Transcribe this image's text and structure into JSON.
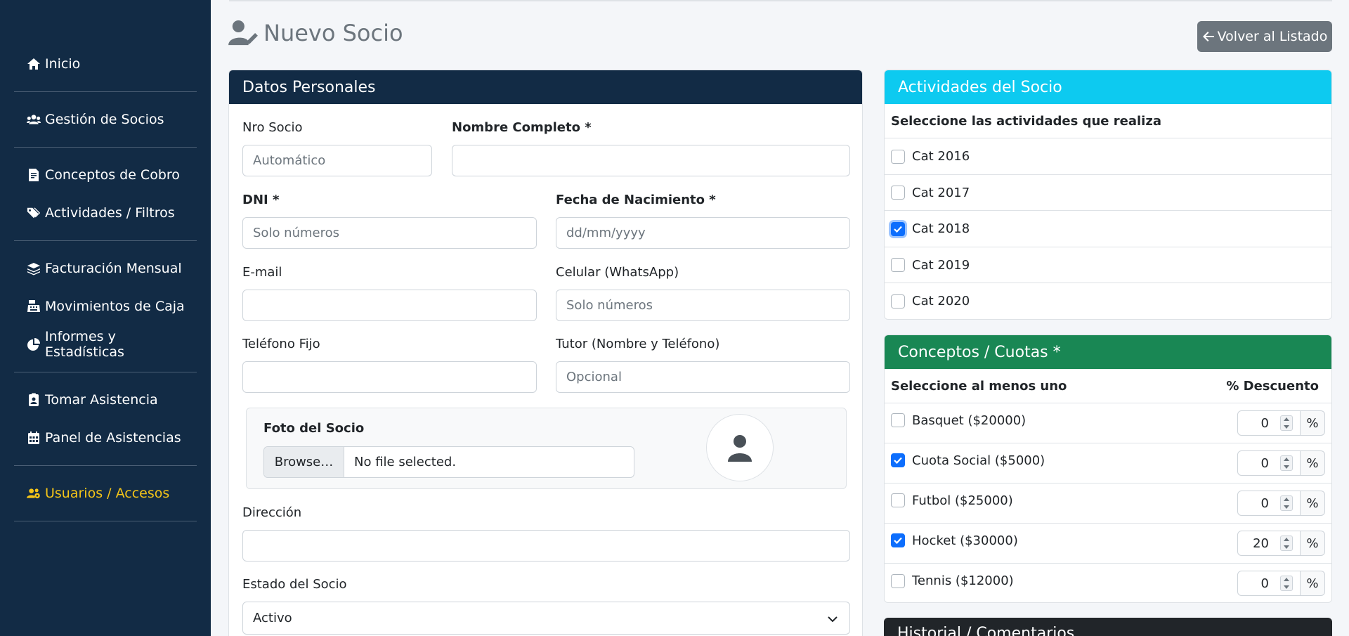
{
  "sidebar": {
    "items": [
      {
        "label": "Inicio",
        "icon": "home-icon"
      },
      {
        "label": "Gestión de Socios",
        "icon": "users-icon"
      },
      {
        "label": "Conceptos de Cobro",
        "icon": "file-invoice-icon"
      },
      {
        "label": "Actividades / Filtros",
        "icon": "tags-icon"
      },
      {
        "label": "Facturación Mensual",
        "icon": "layers-icon"
      },
      {
        "label": "Movimientos de Caja",
        "icon": "cash-register-icon"
      },
      {
        "label": "Informes y Estadísticas",
        "icon": "pie-chart-icon"
      },
      {
        "label": "Tomar Asistencia",
        "icon": "clipboard-user-icon"
      },
      {
        "label": "Panel de Asistencias",
        "icon": "calendar-icon"
      },
      {
        "label": "Usuarios / Accesos",
        "icon": "users-cog-icon",
        "active": true
      }
    ],
    "active_color": "#f5c518"
  },
  "header": {
    "title": "Nuevo Socio",
    "back_button": "Volver al Listado"
  },
  "personal": {
    "title": "Datos Personales",
    "nro_socio": {
      "label": "Nro Socio",
      "placeholder": "Automático"
    },
    "nombre": {
      "label": "Nombre Completo *",
      "value": ""
    },
    "dni": {
      "label": "DNI *",
      "placeholder": "Solo números"
    },
    "fecha": {
      "label": "Fecha de Nacimiento *",
      "placeholder": "dd/mm/yyyy"
    },
    "email": {
      "label": "E-mail",
      "value": ""
    },
    "celular": {
      "label": "Celular (WhatsApp)",
      "placeholder": "Solo números"
    },
    "telefono": {
      "label": "Teléfono Fijo",
      "value": ""
    },
    "tutor": {
      "label": "Tutor (Nombre y Teléfono)",
      "placeholder": "Opcional"
    },
    "foto": {
      "label": "Foto del Socio",
      "browse": "Browse…",
      "file": "No file selected."
    },
    "direccion": {
      "label": "Dirección",
      "value": ""
    },
    "estado": {
      "label": "Estado del Socio",
      "value": "Activo"
    }
  },
  "actividades": {
    "title": "Actividades del Socio",
    "subtitle": "Seleccione las actividades que realiza",
    "items": [
      {
        "label": "Cat 2016",
        "checked": false
      },
      {
        "label": "Cat 2017",
        "checked": false
      },
      {
        "label": "Cat 2018",
        "checked": true
      },
      {
        "label": "Cat 2019",
        "checked": false
      },
      {
        "label": "Cat 2020",
        "checked": false
      }
    ]
  },
  "conceptos": {
    "title": "Conceptos / Cuotas *",
    "subtitle": "Seleccione al menos uno",
    "discount_header": "% Descuento",
    "percent_symbol": "%",
    "items": [
      {
        "label": "Basquet ($20000)",
        "checked": false,
        "discount": "0"
      },
      {
        "label": "Cuota Social ($5000)",
        "checked": true,
        "discount": "0"
      },
      {
        "label": "Futbol ($25000)",
        "checked": false,
        "discount": "0"
      },
      {
        "label": "Hocket ($30000)",
        "checked": true,
        "discount": "20"
      },
      {
        "label": "Tennis ($12000)",
        "checked": false,
        "discount": "0"
      }
    ]
  },
  "historial": {
    "title": "Historial / Comentarios"
  },
  "colors": {
    "sidebar": "#122b45",
    "accent_cyan": "#0dcaf0",
    "accent_green": "#198754",
    "checkbox_blue": "#0d6efd"
  }
}
